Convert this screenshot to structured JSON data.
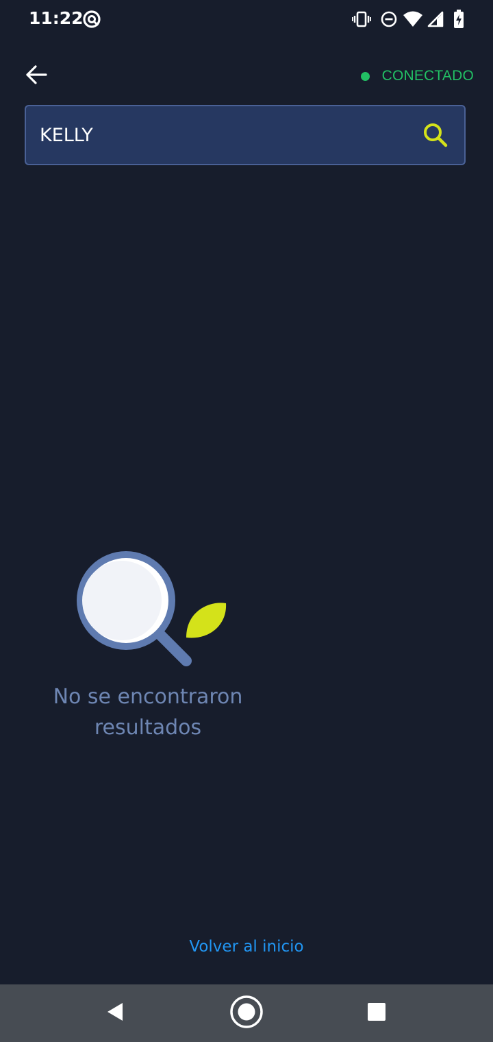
{
  "status_bar": {
    "time": "11:22",
    "icons": [
      "at-sign-icon",
      "vibrate-icon",
      "do-not-disturb-icon",
      "wifi-icon",
      "cell-signal-icon",
      "battery-charging-icon"
    ]
  },
  "header": {
    "back_icon": "arrow-left-icon",
    "connection_status": "CONECTADO",
    "connection_color": "#22c064"
  },
  "search": {
    "value": "KELLY",
    "search_icon": "search-icon",
    "accent_color": "#d4e21a"
  },
  "empty_state": {
    "icon": "magnifier-leaf-illustration",
    "message_line1": "No se encontraron",
    "message_line2": "resultados"
  },
  "footer": {
    "home_link": "Volver al inicio"
  },
  "nav_bar": {
    "buttons": [
      "back-triangle-icon",
      "home-circle-icon",
      "recents-square-icon"
    ]
  },
  "colors": {
    "background": "#171d2c",
    "search_background": "#263861",
    "search_border": "#4a6196",
    "message_text": "#6e86b3",
    "link": "#2196f3",
    "nav_bar": "#474c53"
  }
}
